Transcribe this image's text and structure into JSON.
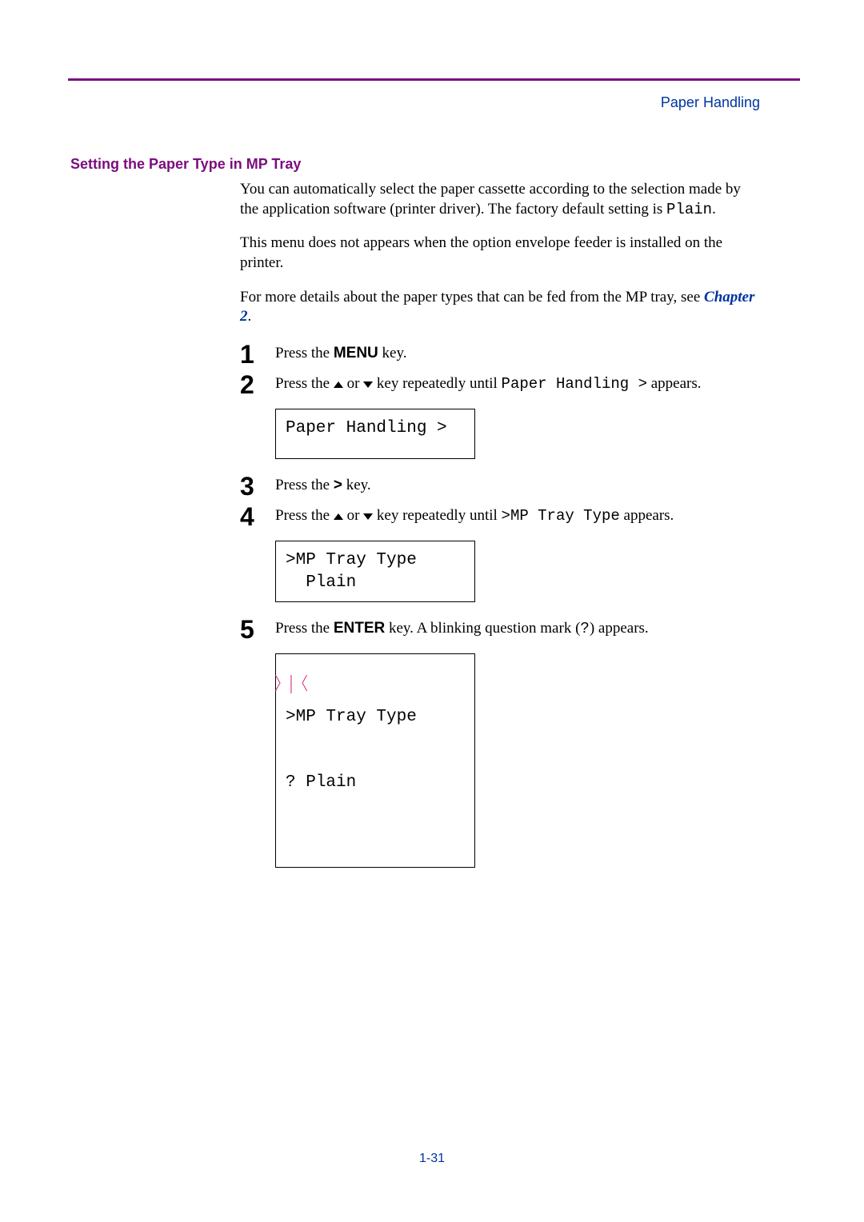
{
  "header": {
    "right": "Paper Handling"
  },
  "section_title": "Setting the Paper Type in MP Tray",
  "paragraphs": {
    "p1a": "You can automatically select the paper cassette according to the selection made by the application software (printer driver). The factory default setting is ",
    "p1_mono": "Plain",
    "p1b": ".",
    "p2": "This menu does not appears when the option envelope feeder is installed on the printer.",
    "p3a": "For more details about the paper types that can be fed from the MP tray, see ",
    "p3_link": "Chapter 2",
    "p3b": "."
  },
  "steps": {
    "s1": {
      "num": "1",
      "pre": "Press the ",
      "bold": "MENU",
      "post": " key."
    },
    "s2": {
      "num": "2",
      "pre": "Press the ",
      "mid": " or ",
      "post_key": " key repeatedly until ",
      "mono": "Paper Handling >",
      "tail": " appears."
    },
    "s2_display": "Paper Handling >",
    "s3": {
      "num": "3",
      "pre": "Press the ",
      "bold": ">",
      "post": " key."
    },
    "s4": {
      "num": "4",
      "pre": "Press the ",
      "mid": " or ",
      "post_key": " key repeatedly until ",
      "mono": ">MP Tray Type",
      "tail": " appears."
    },
    "s4_display": ">MP Tray Type\n  Plain",
    "s5": {
      "num": "5",
      "pre": "Press the ",
      "bold": "ENTER",
      "post": " key. A blinking question mark (",
      "mono": "?",
      "tail": ") appears."
    },
    "s5_display_l1": ">MP Tray Type",
    "s5_display_l2a": "?",
    "s5_display_l2b": " Plain"
  },
  "footer": "1-31"
}
